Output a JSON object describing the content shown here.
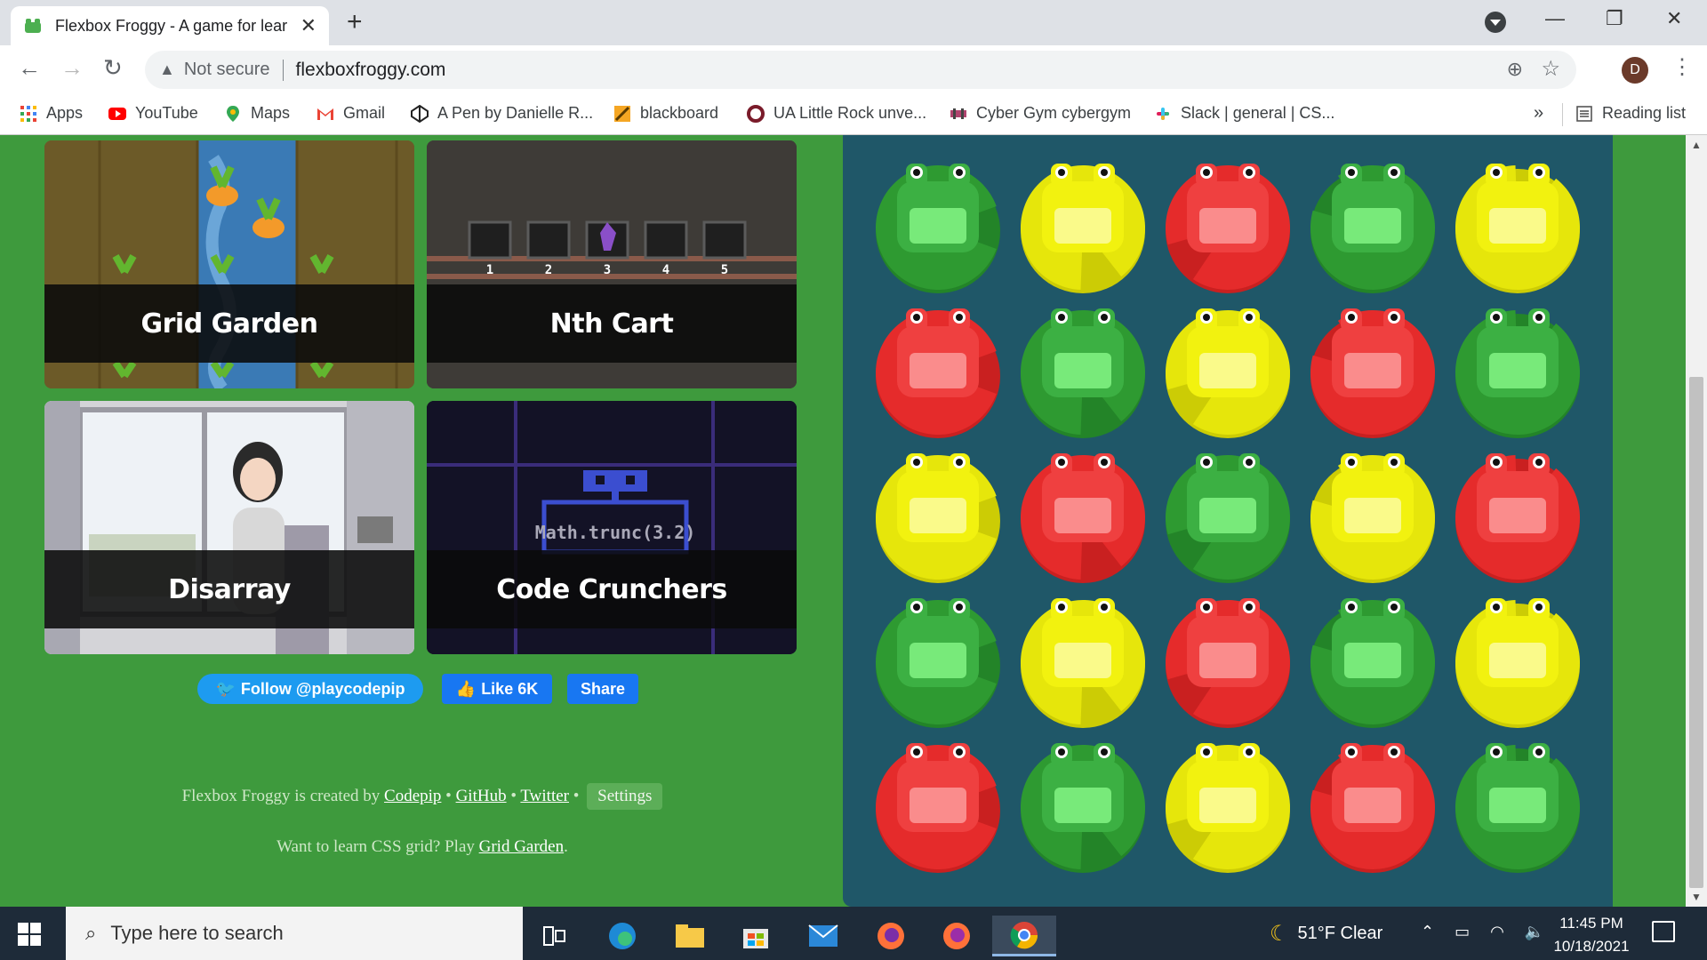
{
  "browser": {
    "tab_title": "Flexbox Froggy - A game for lear",
    "security_label": "Not secure",
    "url": "flexboxfroggy.com",
    "profile_initial": "D",
    "bookmarks": [
      {
        "label": "Apps",
        "icon": "apps-grid-icon"
      },
      {
        "label": "YouTube",
        "icon": "youtube-icon"
      },
      {
        "label": "Maps",
        "icon": "maps-pin-icon"
      },
      {
        "label": "Gmail",
        "icon": "gmail-icon"
      },
      {
        "label": "A Pen by Danielle R...",
        "icon": "codepen-icon"
      },
      {
        "label": "blackboard",
        "icon": "blackboard-icon"
      },
      {
        "label": "UA Little Rock unve...",
        "icon": "ualr-icon"
      },
      {
        "label": "Cyber Gym cybergym",
        "icon": "cybergym-icon"
      },
      {
        "label": "Slack | general | CS...",
        "icon": "slack-icon"
      }
    ],
    "more_bookmarks": "»",
    "reading_list": "Reading list"
  },
  "games": [
    {
      "title": "Grid Garden"
    },
    {
      "title": "Nth Cart"
    },
    {
      "title": "Disarray"
    },
    {
      "title": "Code Crunchers"
    }
  ],
  "nth_cart_numbers": [
    "1",
    "2",
    "3",
    "4",
    "5"
  ],
  "code_crunchers_expression": "Math.trunc(3.2)",
  "social": {
    "follow": "Follow @playcodepip",
    "like": "Like 6K",
    "share": "Share"
  },
  "credits": {
    "prefix": "Flexbox Froggy is created by",
    "codepip": "Codepip",
    "github": "GitHub",
    "twitter": "Twitter",
    "bullet": "•",
    "settings": "Settings"
  },
  "promo": {
    "prefix": "Want to learn CSS grid? Play",
    "link": "Grid Garden",
    "suffix": "."
  },
  "pond": {
    "colors": {
      "green": "#2e9a31",
      "yellow": "#e6e60b",
      "red": "#e52b2b"
    },
    "grid": [
      [
        "green",
        "yellow",
        "red",
        "green",
        "yellow"
      ],
      [
        "red",
        "green",
        "yellow",
        "red",
        "green"
      ],
      [
        "yellow",
        "red",
        "green",
        "yellow",
        "red"
      ],
      [
        "green",
        "yellow",
        "red",
        "green",
        "yellow"
      ],
      [
        "red",
        "green",
        "yellow",
        "red",
        "green"
      ]
    ]
  },
  "taskbar": {
    "search_placeholder": "Type here to search",
    "weather": "51°F  Clear",
    "time": "11:45 PM",
    "date": "10/18/2021"
  }
}
